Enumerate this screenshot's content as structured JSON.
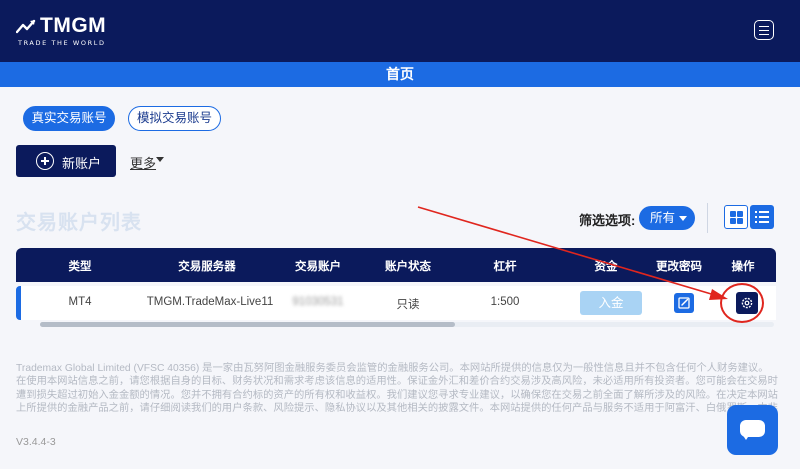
{
  "brand": {
    "name": "TMGM",
    "tagline": "TRADE THE WORLD"
  },
  "page": {
    "title": "首页"
  },
  "account_tabs": [
    {
      "label": "真实交易账号",
      "active": true
    },
    {
      "label": "模拟交易账号",
      "active": false
    }
  ],
  "actions": {
    "new_account": "新账户",
    "more": "更多"
  },
  "list": {
    "title": "交易账户列表",
    "filter_label": "筛选选项:",
    "filter_value": "所有"
  },
  "table": {
    "headers": [
      "类型",
      "交易服务器",
      "交易账户",
      "账户状态",
      "杠杆",
      "资金",
      "更改密码",
      "操作"
    ],
    "rows": [
      {
        "type": "MT4",
        "server": "TMGM.TradeMax-Live11",
        "account": "91030531",
        "status": "只读",
        "leverage": "1:500",
        "deposit_label": "入金"
      }
    ]
  },
  "footer": {
    "disclaimer": "Trademax Global Limited (VFSC 40356) 是一家由瓦努阿图金融服务委员会监管的金融服务公司。本网站所提供的信息仅为一般性信息且并不包含任何个人财务建议。在使用本网站信息之前，请您根据自身的目标、财务状况和需求考虑该信息的适用性。保证金外汇和差价合约交易涉及高风险，未必适用所有投资者。您可能会在交易时遭到损失超过初始入金金额的情况。您并不拥有合约标的资产的所有权和收益权。我们建议您寻求专业建议，以确保您在交易之前全面了解所涉及的风险。在决定本网站上所提供的金融产品之前，请仔细阅读我们的用户条款、风险提示、隐私协议以及其他相关的披露文件。本网站提供的任何产品与服务不适用于阿富汗、白俄罗斯、中非共和国、克里米亚、古巴、刚果民主共和国、几内亚比绍、伊朗、伊拉克、黎巴嫩、利比亚、马里、缅甸、朝鲜、索马里、苏丹、南苏丹、叙利亚、俄罗斯、乌克兰、美国、委内瑞拉、也门、津巴布韦和克里米亚地区",
    "version": "V3.4.4-3"
  },
  "colors": {
    "navy": "#0b1a5c",
    "accent": "#1c6be3",
    "annotation": "#e0261e"
  }
}
